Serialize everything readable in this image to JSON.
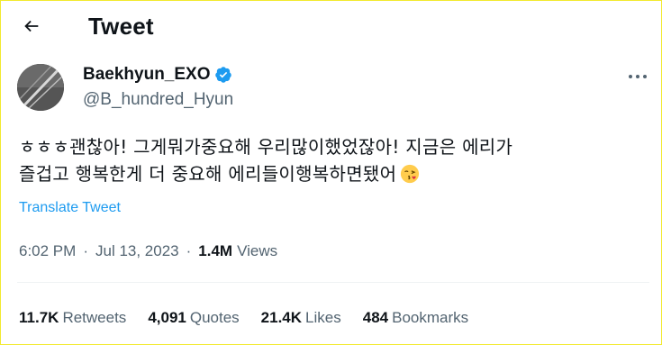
{
  "header": {
    "title": "Tweet"
  },
  "author": {
    "display_name": "Baekhyun_EXO",
    "handle": "@B_hundred_Hyun",
    "verified": true,
    "verified_color": "#1d9bf0"
  },
  "tweet": {
    "text_line1": "ㅎㅎㅎ괜찮아! 그게뭐가중요해 우리많이했었잖아! 지금은 에리가",
    "text_line2": "즐겁고 행복한게 더 중요해 에리들이행복하면됐어",
    "emoji": "kissing-face-with-heart-emoji",
    "translate_label": "Translate Tweet",
    "time": "6:02 PM",
    "date": "Jul 13, 2023",
    "separator": "·",
    "views_count": "1.4M",
    "views_label": "Views"
  },
  "stats": [
    {
      "num": "11.7K",
      "label": "Retweets"
    },
    {
      "num": "4,091",
      "label": "Quotes"
    },
    {
      "num": "21.4K",
      "label": "Likes"
    },
    {
      "num": "484",
      "label": "Bookmarks"
    }
  ],
  "colors": {
    "accent": "#1d9bf0",
    "secondary_text": "#536471",
    "primary_text": "#0f1419",
    "frame_border": "#f2ea2e"
  }
}
